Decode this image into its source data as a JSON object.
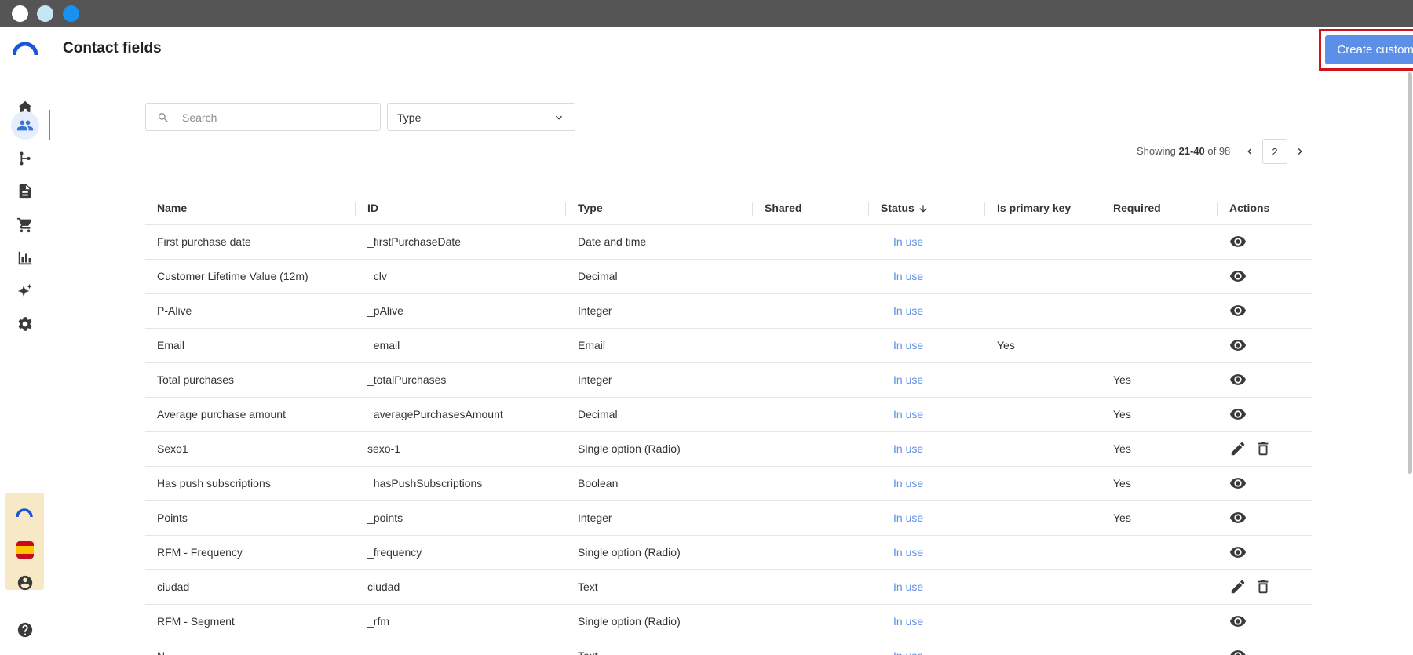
{
  "window": {
    "title": "Contact fields"
  },
  "header": {
    "title": "Contact fields",
    "create_button": "Create custom field"
  },
  "filters": {
    "search_placeholder": "Search",
    "type_label": "Type"
  },
  "pagination": {
    "showing_prefix": "Showing",
    "range": "21-40",
    "of_text": "of 98",
    "page": "2"
  },
  "table": {
    "columns": [
      "Name",
      "ID",
      "Type",
      "Shared",
      "Status",
      "Is primary key",
      "Required",
      "Actions"
    ],
    "rows": [
      {
        "name": "First purchase date",
        "id": "_firstPurchaseDate",
        "type": "Date and time",
        "shared": "",
        "status": "In use",
        "primary_key": "",
        "required": "",
        "actions": [
          "view-icon"
        ]
      },
      {
        "name": "Customer Lifetime Value (12m)",
        "id": "_clv",
        "type": "Decimal",
        "shared": "",
        "status": "In use",
        "primary_key": "",
        "required": "",
        "actions": [
          "view-icon"
        ]
      },
      {
        "name": "P-Alive",
        "id": "_pAlive",
        "type": "Integer",
        "shared": "",
        "status": "In use",
        "primary_key": "",
        "required": "",
        "actions": [
          "view-icon"
        ]
      },
      {
        "name": "Email",
        "id": "_email",
        "type": "Email",
        "shared": "",
        "status": "In use",
        "primary_key": "Yes",
        "required": "",
        "actions": [
          "view-icon"
        ]
      },
      {
        "name": "Total purchases",
        "id": "_totalPurchases",
        "type": "Integer",
        "shared": "",
        "status": "In use",
        "primary_key": "",
        "required": "Yes",
        "actions": [
          "view-icon"
        ]
      },
      {
        "name": "Average purchase amount",
        "id": "_averagePurchasesAmount",
        "type": "Decimal",
        "shared": "",
        "status": "In use",
        "primary_key": "",
        "required": "Yes",
        "actions": [
          "view-icon"
        ]
      },
      {
        "name": "Sexo1",
        "id": "sexo-1",
        "type": "Single option (Radio)",
        "shared": "",
        "status": "In use",
        "primary_key": "",
        "required": "Yes",
        "actions": [
          "edit-icon",
          "delete-icon"
        ]
      },
      {
        "name": "Has push subscriptions",
        "id": "_hasPushSubscriptions",
        "type": "Boolean",
        "shared": "",
        "status": "In use",
        "primary_key": "",
        "required": "Yes",
        "actions": [
          "view-icon"
        ]
      },
      {
        "name": "Points",
        "id": "_points",
        "type": "Integer",
        "shared": "",
        "status": "In use",
        "primary_key": "",
        "required": "Yes",
        "actions": [
          "view-icon"
        ]
      },
      {
        "name": "RFM - Frequency",
        "id": "_frequency",
        "type": "Single option (Radio)",
        "shared": "",
        "status": "In use",
        "primary_key": "",
        "required": "",
        "actions": [
          "view-icon"
        ]
      },
      {
        "name": "ciudad",
        "id": "ciudad",
        "type": "Text",
        "shared": "",
        "status": "In use",
        "primary_key": "",
        "required": "",
        "actions": [
          "edit-icon",
          "delete-icon"
        ]
      },
      {
        "name": "RFM - Segment",
        "id": "_rfm",
        "type": "Single option (Radio)",
        "shared": "",
        "status": "In use",
        "primary_key": "",
        "required": "",
        "actions": [
          "view-icon"
        ]
      },
      {
        "name": "N...",
        "id": "",
        "type": "Text",
        "shared": "",
        "status": "In use",
        "primary_key": "",
        "required": "",
        "actions": [
          "view-icon"
        ]
      }
    ]
  },
  "sidebar": {
    "items": [
      {
        "name": "home-icon",
        "active": false
      },
      {
        "name": "contacts-icon",
        "active": true
      },
      {
        "name": "flows-icon",
        "active": false
      },
      {
        "name": "templates-icon",
        "active": false
      },
      {
        "name": "ecommerce-icon",
        "active": false
      },
      {
        "name": "analytics-icon",
        "active": false
      },
      {
        "name": "ai-sparkle-icon",
        "active": false
      },
      {
        "name": "settings-icon",
        "active": false
      }
    ]
  },
  "colors": {
    "accent": "#5b8fe8",
    "highlight_border": "#d0121b",
    "titlebar": "#555555",
    "status_link": "#5b8fe8"
  }
}
